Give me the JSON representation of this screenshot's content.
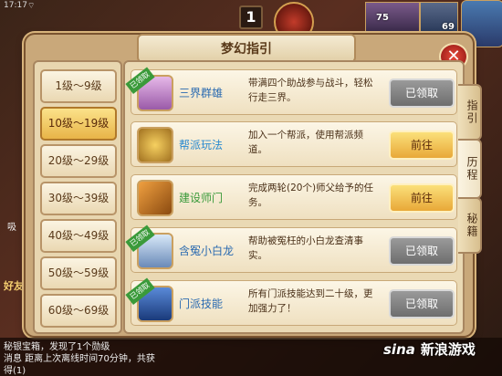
{
  "status": {
    "time": "17:17"
  },
  "hud": {
    "count": "1",
    "num_a": "75",
    "num_b": "69"
  },
  "dialog": {
    "title": "梦幻指引",
    "close_label": "✕"
  },
  "levels": [
    {
      "label": "1级～9级"
    },
    {
      "label": "10级～19级"
    },
    {
      "label": "20级～29级"
    },
    {
      "label": "30级～39级"
    },
    {
      "label": "40级～49级"
    },
    {
      "label": "50级～59级"
    },
    {
      "label": "60级～69级"
    }
  ],
  "quests": [
    {
      "name": "三界群雄",
      "desc": "带满四个助战参与战斗，轻松行走三界。",
      "button": "已领取",
      "ribbon": "已领取"
    },
    {
      "name": "帮派玩法",
      "desc": "加入一个帮派，使用帮派频道。",
      "button": "前往",
      "ribbon": ""
    },
    {
      "name": "建设师门",
      "desc": "完成两轮(20个)师父给予的任务。",
      "button": "前往",
      "ribbon": ""
    },
    {
      "name": "含冤小白龙",
      "desc": "帮助被冤枉的小白龙查清事实。",
      "button": "已领取",
      "ribbon": "已领取"
    },
    {
      "name": "门派技能",
      "desc": "所有门派技能达到二十级，更加强力了！",
      "button": "已领取",
      "ribbon": "已领取"
    }
  ],
  "tabs": [
    {
      "label": "指引"
    },
    {
      "label": "历程"
    },
    {
      "label": "秘籍"
    }
  ],
  "chat": {
    "line1": "秘银宝箱，发现了1个勋级",
    "line2": "消息 距离上次离线时间70分钟，共获",
    "line3": "得(1)"
  },
  "side": {
    "skill": "吸",
    "good": "好友"
  },
  "watermark": "新浪游戏",
  "watermark_brand": "sina",
  "colors": {
    "accent": "#e8b448",
    "claimed": "#8a8a8a",
    "ribbon": "#3a9a3a"
  }
}
